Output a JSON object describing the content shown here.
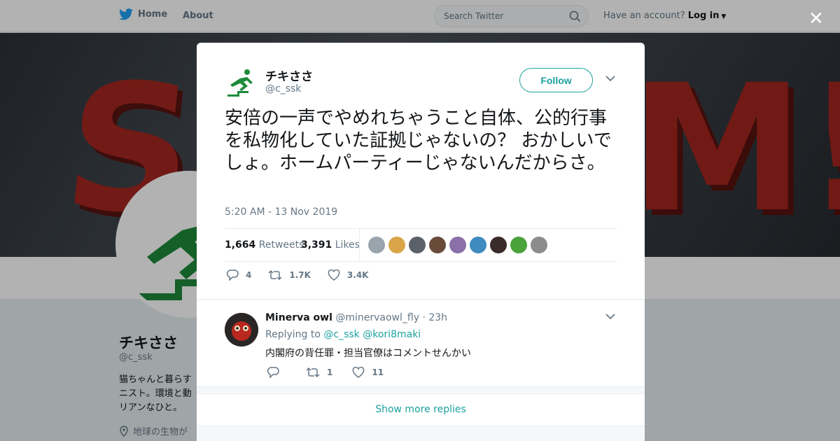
{
  "nav": {
    "home_label": "Home",
    "about_label": "About",
    "search_placeholder": "Search Twitter",
    "account_prompt": "Have an account?",
    "login_label": "Log in"
  },
  "profile": {
    "name": "チキささ",
    "handle": "@c_ssk",
    "bio": "猫ちゃんと暮らす ニスト。環境と動 リアンなひと。",
    "location": "地球の生物が"
  },
  "tweet": {
    "name": "チキささ",
    "handle": "@c_ssk",
    "follow_label": "Follow",
    "text": "安倍の一声でやめれちゃうこと自体、公的行事を私物化していた証拠じゃないの？ おかしいでしょ。ホームパーティーじゃないんだからさ。",
    "timestamp": "5:20 AM - 13 Nov 2019",
    "retweets_count": "1,664",
    "retweets_label": "Retweets",
    "likes_count": "3,391",
    "likes_label": "Likes",
    "likers": [
      "#9aa4ad",
      "#d9a548",
      "#5b6168",
      "#6a4b3a",
      "#8a6fa8",
      "#3f8bc0",
      "#3a2b2b",
      "#4aa33a",
      "#8c8c8c"
    ],
    "actions": {
      "replies": "4",
      "retweets": "1.7K",
      "likes": "3.4K"
    }
  },
  "reply": {
    "name": "Minerva owl",
    "handle": "@minervaowl_fly",
    "time": "· 23h",
    "replying_prefix": "Replying to",
    "mention1": "@c_ssk",
    "mention2": "@kori8maki",
    "text": "内閣府の背任罪・担当官僚はコメントせんかい",
    "actions": {
      "replies": "",
      "retweets": "1",
      "likes": "11"
    }
  },
  "show_more_label": "Show more replies",
  "colors": {
    "accent": "#1da1a0",
    "twitter_blue": "#1da1f2",
    "logo_green": "#1d8a3a"
  }
}
